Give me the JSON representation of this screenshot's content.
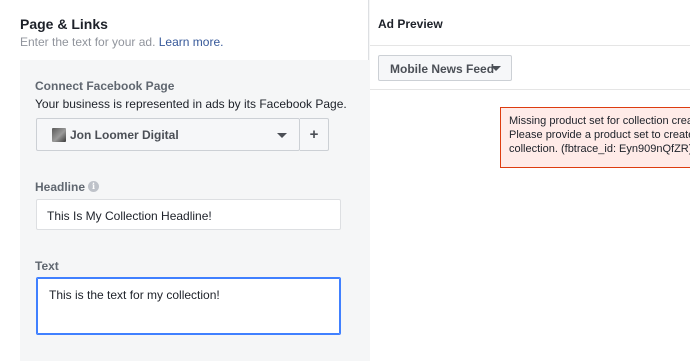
{
  "left": {
    "title": "Page & Links",
    "subtitle": "Enter the text for your ad.",
    "learn_more": "Learn more.",
    "connect": {
      "label": "Connect Facebook Page",
      "description": "Your business is represented in ads by its Facebook Page.",
      "selected_page": "Jon Loomer Digital",
      "add_button": "+"
    },
    "headline": {
      "label": "Headline",
      "info_icon": "i",
      "value": "This Is My Collection Headline!"
    },
    "text": {
      "label": "Text",
      "value": "This is the text for my collection!"
    }
  },
  "preview": {
    "title": "Ad Preview",
    "placement": "Mobile News Feed",
    "error_lines": [
      "Missing product set for collection creat",
      "Please provide a product set to create",
      "collection. (fbtrace_id: Eyn909nQfZR)"
    ]
  },
  "colors": {
    "link": "#365899",
    "focus_border": "#4080ff",
    "error_border": "#dd3c10",
    "error_bg": "#ffebe8"
  },
  "icons": [
    "page-avatar-icon",
    "chevron-down-icon",
    "info-icon"
  ]
}
